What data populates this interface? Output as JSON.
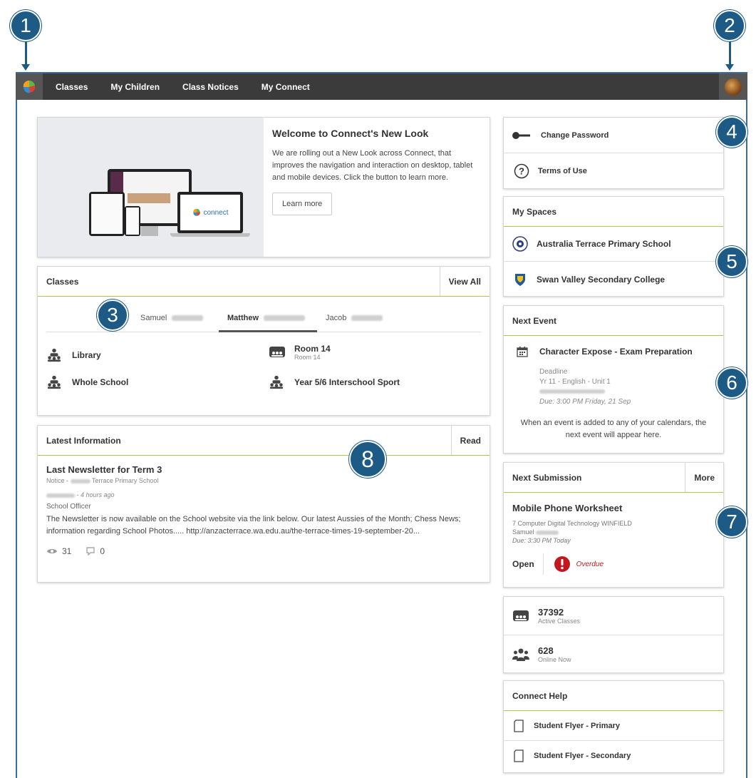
{
  "nav": {
    "items": [
      "Classes",
      "My Children",
      "Class Notices",
      "My Connect"
    ]
  },
  "callouts": [
    "1",
    "2",
    "3",
    "4",
    "5",
    "6",
    "7",
    "8"
  ],
  "welcome": {
    "title": "Welcome to Connect's New Look",
    "body": "We are rolling out a New Look across Connect, that improves the navigation and interaction on desktop, tablet and mobile devices. Click the button to learn more.",
    "button": "Learn more",
    "screen_brand": "connect"
  },
  "classes": {
    "header": "Classes",
    "action": "View All",
    "tabs": [
      "Samuel",
      "Matthew",
      "Jacob"
    ],
    "items": [
      {
        "name": "Library",
        "sub": ""
      },
      {
        "name": "Room 14",
        "sub": "Room 14"
      },
      {
        "name": "Whole School",
        "sub": ""
      },
      {
        "name": "Year 5/6 Interschool Sport",
        "sub": ""
      }
    ]
  },
  "latest": {
    "header": "Latest Information",
    "action": "Read",
    "title": "Last Newsletter for Term 3",
    "notice_prefix": "Notice -",
    "notice_school": "Terrace Primary School",
    "time": "- 4 hours ago",
    "author": "School Officer",
    "body": "The Newsletter is now available on the School website via the link below. Our latest Aussies of the Month; Chess News; information regarding School Photos..... http://anzacterrace.wa.edu.au/the-terrace-times-19-september-20...",
    "views": "31",
    "comments": "0"
  },
  "account": {
    "change_password": "Change Password",
    "terms": "Terms of Use"
  },
  "spaces": {
    "header": "My Spaces",
    "items": [
      "Australia Terrace Primary School",
      "Swan Valley Secondary College"
    ]
  },
  "next_event": {
    "header": "Next Event",
    "title": "Character Expose - Exam Preparation",
    "type": "Deadline",
    "course": "Yr 11 - English - Unit 1",
    "due": "Due: 3:00 PM Friday, 21 Sep",
    "note": "When an event is added to any of your calendars, the next event will appear here."
  },
  "next_submission": {
    "header": "Next Submission",
    "action": "More",
    "title": "Mobile Phone Worksheet",
    "course": "7 Computer Digital Technology WINFIELD",
    "student": "Samuel",
    "due": "Due: 3:30 PM Today",
    "open": "Open",
    "status": "Overdue"
  },
  "stats": {
    "active_classes_value": "37392",
    "active_classes_label": "Active Classes",
    "online_value": "628",
    "online_label": "Online Now"
  },
  "help": {
    "header": "Connect Help",
    "items": [
      "Student Flyer - Primary",
      "Student Flyer - Secondary"
    ]
  },
  "colors": {
    "accent_green": "#a8c94a",
    "callout_blue": "#1d5a86",
    "topbar": "#3b3b3b",
    "overdue_red": "#c0181e"
  }
}
